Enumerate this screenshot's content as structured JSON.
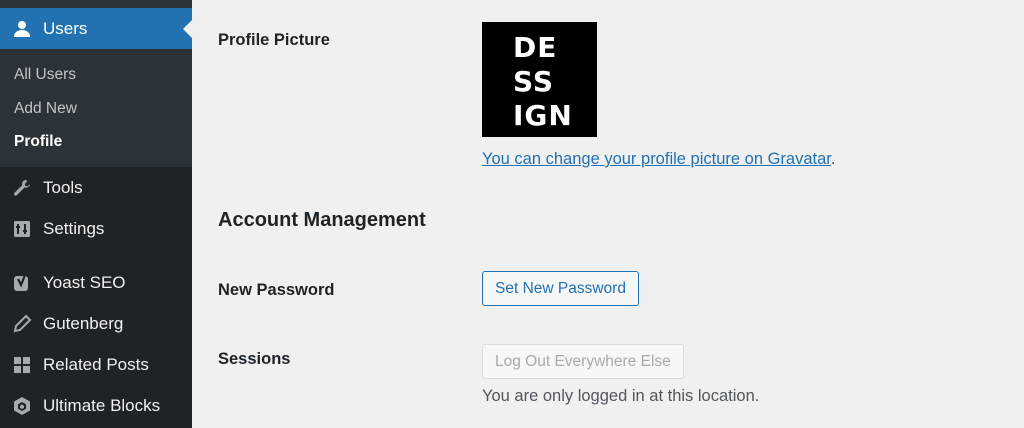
{
  "sidebar": {
    "users_label": "Users",
    "submenu": [
      {
        "label": "All Users"
      },
      {
        "label": "Add New"
      },
      {
        "label": "Profile"
      }
    ],
    "items": [
      {
        "label": "Tools",
        "icon": "wrench-icon"
      },
      {
        "label": "Settings",
        "icon": "settings-icon"
      },
      {
        "label": "Yoast SEO",
        "icon": "yoast-icon"
      },
      {
        "label": "Gutenberg",
        "icon": "pencil-icon"
      },
      {
        "label": "Related Posts",
        "icon": "grid-icon"
      },
      {
        "label": "Ultimate Blocks",
        "icon": "hexagon-icon"
      }
    ]
  },
  "profile_picture": {
    "label": "Profile Picture",
    "avatar_lines": [
      "DE",
      "SS",
      "IGN"
    ],
    "gravatar_link": "You can change your profile picture on Gravatar",
    "gravatar_suffix": "."
  },
  "account": {
    "title": "Account Management",
    "new_password_label": "New Password",
    "set_password_button": "Set New Password",
    "sessions_label": "Sessions",
    "logout_button": "Log Out Everywhere Else",
    "sessions_note": "You are only logged in at this location."
  },
  "colors": {
    "sidebar_bg": "#1d2327",
    "submenu_bg": "#2c3338",
    "accent": "#2271b1",
    "page_bg": "#f0f0f1"
  }
}
